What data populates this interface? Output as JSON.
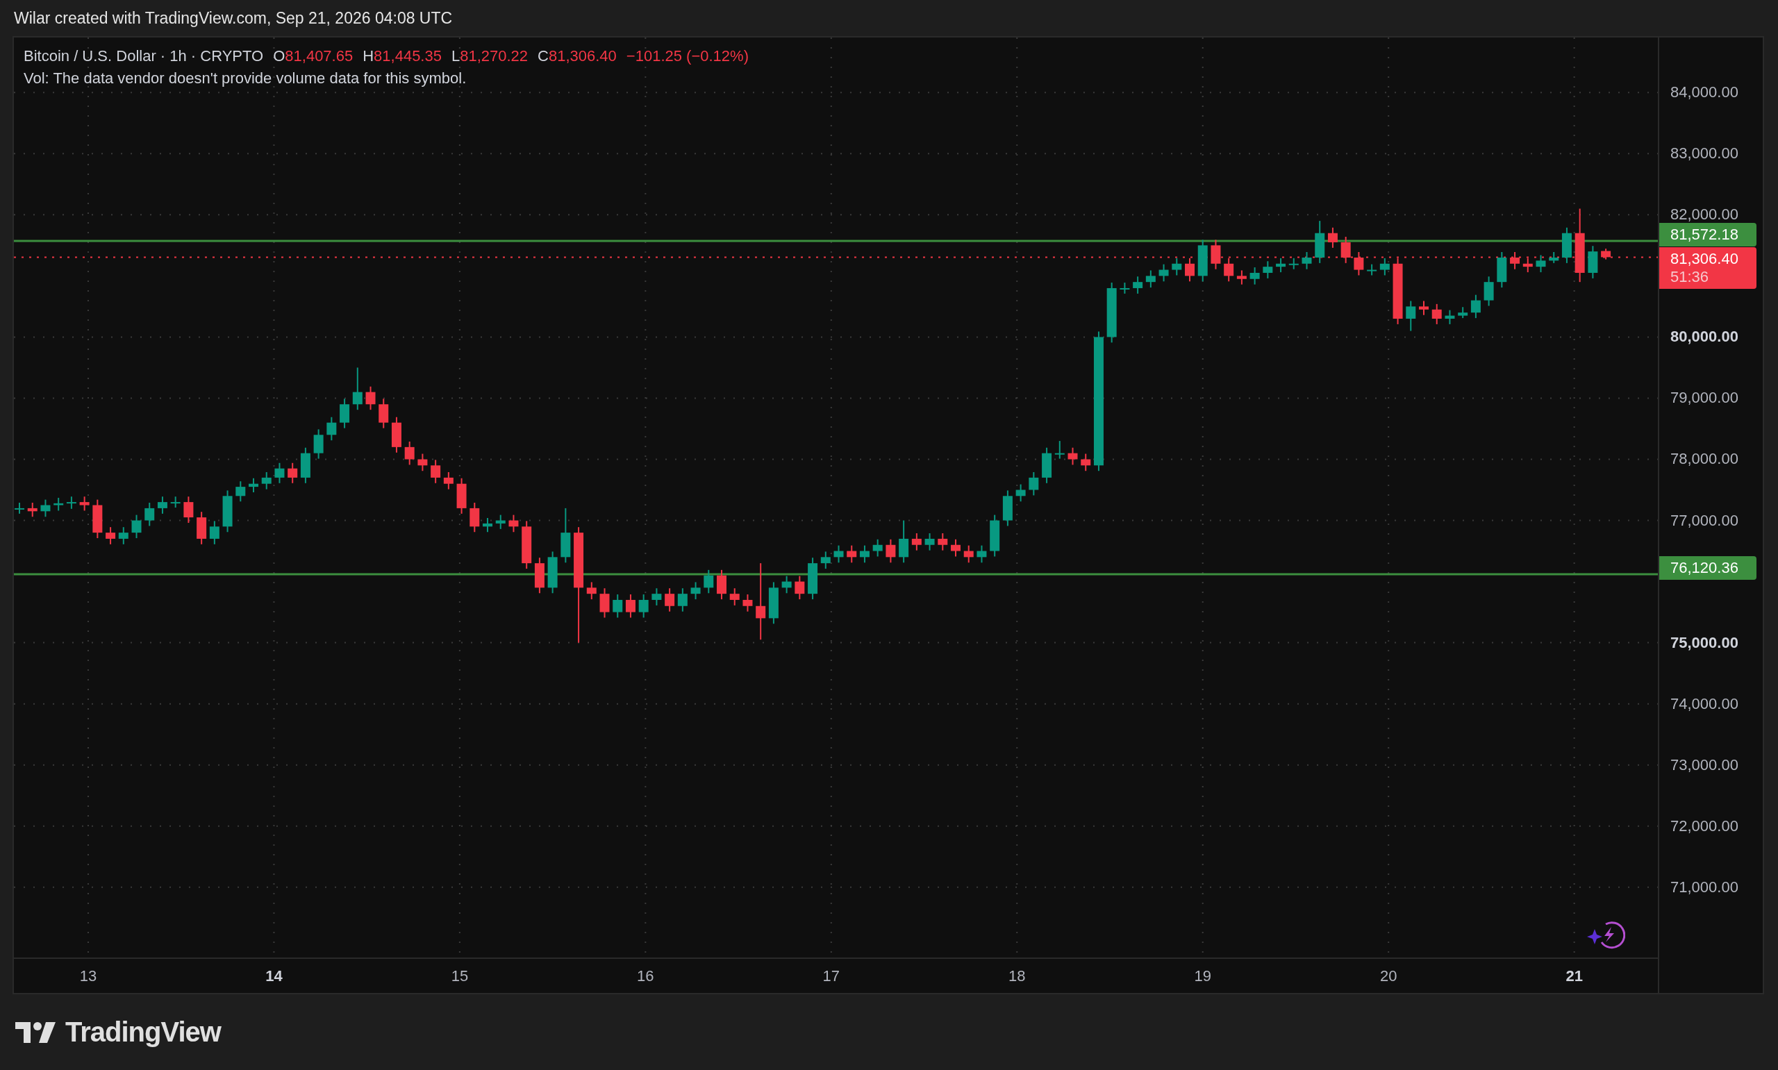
{
  "header": {
    "text": "Wilar created with TradingView.com, Sep 21, 2026 04:08 UTC"
  },
  "legend": {
    "symbol": "Bitcoin / U.S. Dollar · 1h · CRYPTO",
    "fields": [
      {
        "key": "O",
        "value": "81,407.65"
      },
      {
        "key": "H",
        "value": "81,445.35"
      },
      {
        "key": "L",
        "value": "81,270.22"
      },
      {
        "key": "C",
        "value": "81,306.40"
      }
    ],
    "change": "−101.25 (−0.12%)",
    "volume_note": "Vol: The data vendor doesn't provide volume data for this symbol."
  },
  "chart_data": {
    "type": "candlestick",
    "xlim": [
      12.6,
      21.45
    ],
    "ylim": [
      69850,
      84900
    ],
    "x": [
      12.63,
      12.7,
      12.77,
      12.84,
      12.91,
      12.98,
      13.05,
      13.12,
      13.19,
      13.26,
      13.33,
      13.4,
      13.47,
      13.54,
      13.61,
      13.68,
      13.75,
      13.82,
      13.89,
      13.96,
      14.03,
      14.1,
      14.17,
      14.24,
      14.31,
      14.38,
      14.45,
      14.52,
      14.59,
      14.66,
      14.73,
      14.8,
      14.87,
      14.94,
      15.01,
      15.08,
      15.15,
      15.22,
      15.29,
      15.36,
      15.43,
      15.5,
      15.57,
      15.64,
      15.71,
      15.78,
      15.85,
      15.92,
      15.99,
      16.06,
      16.13,
      16.2,
      16.27,
      16.34,
      16.41,
      16.48,
      16.55,
      16.62,
      16.69,
      16.76,
      16.83,
      16.9,
      16.97,
      17.04,
      17.11,
      17.18,
      17.25,
      17.32,
      17.39,
      17.46,
      17.53,
      17.6,
      17.67,
      17.74,
      17.81,
      17.88,
      17.95,
      18.02,
      18.09,
      18.16,
      18.23,
      18.3,
      18.37,
      18.44,
      18.51,
      18.58,
      18.65,
      18.72,
      18.79,
      18.86,
      18.93,
      19.0,
      19.07,
      19.14,
      19.21,
      19.28,
      19.35,
      19.42,
      19.49,
      19.56,
      19.63,
      19.7,
      19.77,
      19.84,
      19.91,
      19.98,
      20.05,
      20.12,
      20.19,
      20.26,
      20.33,
      20.4,
      20.47,
      20.54,
      20.61,
      20.68,
      20.75,
      20.82,
      20.89,
      20.96,
      21.03,
      21.1,
      21.17
    ],
    "ohlc": [
      [
        77200,
        77290,
        77110,
        77200
      ],
      [
        77200,
        77290,
        77060,
        77150
      ],
      [
        77150,
        77340,
        77060,
        77250
      ],
      [
        77250,
        77370,
        77160,
        77280
      ],
      [
        77280,
        77390,
        77190,
        77300
      ],
      [
        77300,
        77390,
        77160,
        77250
      ],
      [
        77250,
        77340,
        76710,
        76800
      ],
      [
        76800,
        76890,
        76610,
        76700
      ],
      [
        76700,
        76890,
        76610,
        76800
      ],
      [
        76800,
        77090,
        76710,
        77000
      ],
      [
        77000,
        77290,
        76910,
        77200
      ],
      [
        77200,
        77390,
        77110,
        77300
      ],
      [
        77300,
        77390,
        77210,
        77300
      ],
      [
        77300,
        77390,
        76960,
        77050
      ],
      [
        77050,
        77140,
        76610,
        76700
      ],
      [
        76700,
        76990,
        76610,
        76900
      ],
      [
        76900,
        77490,
        76810,
        77400
      ],
      [
        77400,
        77640,
        77310,
        77550
      ],
      [
        77550,
        77690,
        77460,
        77600
      ],
      [
        77600,
        77790,
        77510,
        77700
      ],
      [
        77700,
        77940,
        77610,
        77850
      ],
      [
        77850,
        77940,
        77610,
        77700
      ],
      [
        77700,
        78190,
        77610,
        78100
      ],
      [
        78100,
        78490,
        78010,
        78400
      ],
      [
        78400,
        78690,
        78310,
        78600
      ],
      [
        78600,
        78990,
        78510,
        78900
      ],
      [
        78900,
        79500,
        78810,
        79100
      ],
      [
        79100,
        79190,
        78810,
        78900
      ],
      [
        78900,
        78990,
        78510,
        78600
      ],
      [
        78600,
        78690,
        78110,
        78200
      ],
      [
        78200,
        78290,
        77910,
        78000
      ],
      [
        78000,
        78090,
        77810,
        77900
      ],
      [
        77900,
        77990,
        77610,
        77700
      ],
      [
        77700,
        77790,
        77510,
        77600
      ],
      [
        77600,
        77690,
        77110,
        77200
      ],
      [
        77200,
        77290,
        76810,
        76900
      ],
      [
        76900,
        77040,
        76810,
        76950
      ],
      [
        76950,
        77090,
        76860,
        77000
      ],
      [
        77000,
        77090,
        76810,
        76900
      ],
      [
        76900,
        76990,
        76210,
        76300
      ],
      [
        76300,
        76390,
        75810,
        75900
      ],
      [
        75900,
        76490,
        75810,
        76400
      ],
      [
        76400,
        77200,
        76310,
        76800
      ],
      [
        76800,
        76890,
        75000,
        75900
      ],
      [
        75900,
        75990,
        75710,
        75800
      ],
      [
        75800,
        75890,
        75410,
        75500
      ],
      [
        75500,
        75790,
        75410,
        75700
      ],
      [
        75700,
        75790,
        75410,
        75500
      ],
      [
        75500,
        75790,
        75410,
        75700
      ],
      [
        75700,
        75890,
        75610,
        75800
      ],
      [
        75800,
        75890,
        75510,
        75600
      ],
      [
        75600,
        75890,
        75510,
        75800
      ],
      [
        75800,
        75990,
        75710,
        75900
      ],
      [
        75900,
        76190,
        75810,
        76100
      ],
      [
        76100,
        76190,
        75710,
        75800
      ],
      [
        75800,
        75890,
        75610,
        75700
      ],
      [
        75700,
        75790,
        75510,
        75600
      ],
      [
        75600,
        76300,
        75050,
        75400
      ],
      [
        75400,
        75990,
        75310,
        75900
      ],
      [
        75900,
        76090,
        75810,
        76000
      ],
      [
        76000,
        76090,
        75710,
        75800
      ],
      [
        75800,
        76390,
        75710,
        76300
      ],
      [
        76300,
        76490,
        76210,
        76400
      ],
      [
        76400,
        76590,
        76310,
        76500
      ],
      [
        76500,
        76590,
        76310,
        76400
      ],
      [
        76400,
        76590,
        76310,
        76500
      ],
      [
        76500,
        76690,
        76410,
        76600
      ],
      [
        76600,
        76690,
        76310,
        76400
      ],
      [
        76400,
        77000,
        76310,
        76700
      ],
      [
        76700,
        76790,
        76510,
        76600
      ],
      [
        76600,
        76790,
        76510,
        76700
      ],
      [
        76700,
        76790,
        76510,
        76600
      ],
      [
        76600,
        76690,
        76410,
        76500
      ],
      [
        76500,
        76590,
        76310,
        76400
      ],
      [
        76400,
        76590,
        76310,
        76500
      ],
      [
        76500,
        77090,
        76410,
        77000
      ],
      [
        77000,
        77490,
        76910,
        77400
      ],
      [
        77400,
        77590,
        77310,
        77500
      ],
      [
        77500,
        77790,
        77410,
        77700
      ],
      [
        77700,
        78190,
        77610,
        78100
      ],
      [
        78100,
        78300,
        78010,
        78100
      ],
      [
        78100,
        78190,
        77910,
        78000
      ],
      [
        78000,
        78090,
        77810,
        77900
      ],
      [
        77900,
        80090,
        77810,
        80000
      ],
      [
        80000,
        80890,
        79910,
        80800
      ],
      [
        80800,
        80890,
        80710,
        80800
      ],
      [
        80800,
        80990,
        80710,
        80900
      ],
      [
        80900,
        81090,
        80810,
        81000
      ],
      [
        81000,
        81190,
        80910,
        81100
      ],
      [
        81100,
        81290,
        81010,
        81200
      ],
      [
        81200,
        81290,
        80910,
        81000
      ],
      [
        81000,
        81590,
        80910,
        81500
      ],
      [
        81500,
        81590,
        81110,
        81200
      ],
      [
        81200,
        81290,
        80910,
        81000
      ],
      [
        81000,
        81090,
        80860,
        80950
      ],
      [
        80950,
        81140,
        80860,
        81050
      ],
      [
        81050,
        81240,
        80960,
        81150
      ],
      [
        81150,
        81290,
        81060,
        81200
      ],
      [
        81200,
        81290,
        81110,
        81200
      ],
      [
        81200,
        81390,
        81110,
        81300
      ],
      [
        81300,
        81900,
        81210,
        81700
      ],
      [
        81700,
        81790,
        81460,
        81550
      ],
      [
        81550,
        81640,
        81210,
        81300
      ],
      [
        81300,
        81390,
        81010,
        81100
      ],
      [
        81100,
        81190,
        81010,
        81100
      ],
      [
        81100,
        81290,
        81010,
        81200
      ],
      [
        81200,
        81290,
        80210,
        80300
      ],
      [
        80300,
        80590,
        80100,
        80500
      ],
      [
        80500,
        80590,
        80360,
        80450
      ],
      [
        80450,
        80540,
        80210,
        80300
      ],
      [
        80300,
        80440,
        80210,
        80350
      ],
      [
        80350,
        80490,
        80310,
        80400
      ],
      [
        80400,
        80690,
        80310,
        80600
      ],
      [
        80600,
        80990,
        80510,
        80900
      ],
      [
        80900,
        81390,
        80810,
        81300
      ],
      [
        81300,
        81390,
        81110,
        81200
      ],
      [
        81200,
        81290,
        81060,
        81150
      ],
      [
        81150,
        81340,
        81060,
        81250
      ],
      [
        81250,
        81390,
        81210,
        81300
      ],
      [
        81300,
        81790,
        81210,
        81700
      ],
      [
        81700,
        82100,
        80900,
        81050
      ],
      [
        81050,
        81490,
        80960,
        81400
      ],
      [
        81407.65,
        81445.35,
        81270.22,
        81306.4
      ]
    ],
    "yticks": [
      {
        "value": 84000,
        "label": "84,000.00"
      },
      {
        "value": 83000,
        "label": "83,000.00"
      },
      {
        "value": 82000,
        "label": "82,000.00"
      },
      {
        "value": 80000,
        "label": "80,000.00"
      },
      {
        "value": 79000,
        "label": "79,000.00"
      },
      {
        "value": 78000,
        "label": "78,000.00"
      },
      {
        "value": 77000,
        "label": "77,000.00"
      },
      {
        "value": 75000,
        "label": "75,000.00"
      },
      {
        "value": 74000,
        "label": "74,000.00"
      },
      {
        "value": 73000,
        "label": "73,000.00"
      },
      {
        "value": 72000,
        "label": "72,000.00"
      },
      {
        "value": 71000,
        "label": "71,000.00"
      }
    ],
    "xticks": [
      {
        "value": 13,
        "label": "13"
      },
      {
        "value": 14,
        "label": "14"
      },
      {
        "value": 15,
        "label": "15"
      },
      {
        "value": 16,
        "label": "16"
      },
      {
        "value": 17,
        "label": "17"
      },
      {
        "value": 18,
        "label": "18"
      },
      {
        "value": 19,
        "label": "19"
      },
      {
        "value": 20,
        "label": "20"
      },
      {
        "value": 21,
        "label": "21"
      }
    ],
    "grid": true,
    "ref_lines": [
      {
        "axis": "y",
        "value": 81572.18,
        "label": "81,572.18",
        "color": "#3c8f3f"
      },
      {
        "axis": "y",
        "value": 76120.36,
        "label": "76,120.36",
        "color": "#3c8f3f"
      },
      {
        "axis": "y",
        "value": 81306.4,
        "label": "81,306.40",
        "color": "#f23645"
      }
    ]
  },
  "last_price": {
    "countdown": "51:36"
  },
  "footer": {
    "brand": "TradingView"
  }
}
